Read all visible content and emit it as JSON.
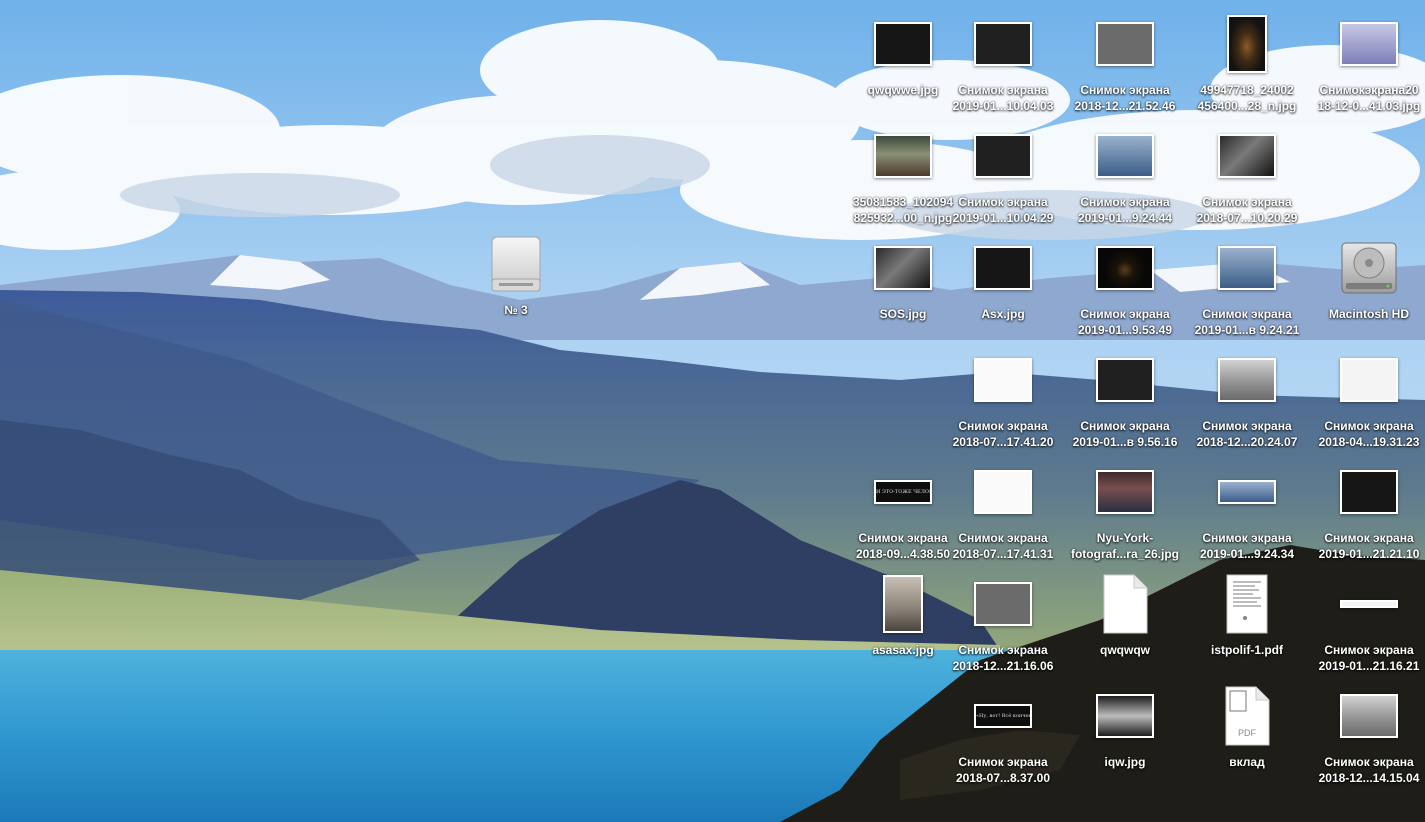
{
  "desktop": {
    "drive_icon": {
      "label": "№ 3",
      "icon": "external-drive-icon"
    },
    "icons": [
      {
        "name": "qwqwwe-jpg",
        "lines": [
          "qwqwwe.jpg"
        ],
        "kind": "image",
        "thumb": "w",
        "fill": "f-dark",
        "icon": "image-thumbnail-icon"
      },
      {
        "name": "screenshot-2019-01-10-04-03",
        "lines": [
          "Снимок экрана",
          "2019-01...10.04.03"
        ],
        "kind": "image",
        "thumb": "w",
        "fill": "f-dark2",
        "icon": "image-thumbnail-icon"
      },
      {
        "name": "screenshot-2018-12-21-52-46",
        "lines": [
          "Снимок экрана",
          "2018-12...21.52.46"
        ],
        "kind": "image",
        "thumb": "w",
        "fill": "f-gray",
        "icon": "image-thumbnail-icon"
      },
      {
        "name": "49947718-jpg",
        "lines": [
          "49947718_24002",
          "456400...28_n.jpg"
        ],
        "kind": "image",
        "thumb": "p",
        "fill": "f-bottle",
        "icon": "image-thumbnail-icon"
      },
      {
        "name": "snimokekrana2018-12-41-03",
        "lines": [
          "Снимокэкрана20",
          "18-12-0...41.03.jpg"
        ],
        "kind": "image",
        "thumb": "w",
        "fill": "f-lilac",
        "icon": "image-thumbnail-icon"
      },
      {
        "name": "35081583-jpg",
        "lines": [
          "35081583_102094",
          "825932...00_n.jpg"
        ],
        "kind": "image",
        "thumb": "w",
        "fill": "f-crowd",
        "icon": "image-thumbnail-icon"
      },
      {
        "name": "screenshot-2019-01-10-04-29",
        "lines": [
          "Снимок экрана",
          "2019-01...10.04.29"
        ],
        "kind": "image",
        "thumb": "w",
        "fill": "f-dark2",
        "icon": "image-thumbnail-icon"
      },
      {
        "name": "screenshot-2019-01-9-24-44",
        "lines": [
          "Снимок экрана",
          "2019-01...9.24.44"
        ],
        "kind": "image",
        "thumb": "w",
        "fill": "f-blue",
        "icon": "image-thumbnail-icon"
      },
      {
        "name": "screenshot-2018-07-10-20-29",
        "lines": [
          "Снимок экрана",
          "2018-07...10.20.29"
        ],
        "kind": "image",
        "thumb": "w",
        "fill": "f-bw",
        "icon": "image-thumbnail-icon"
      },
      {
        "name": "sos-jpg",
        "lines": [
          "SOS.jpg"
        ],
        "kind": "image",
        "thumb": "w",
        "fill": "f-bw",
        "icon": "image-thumbnail-icon"
      },
      {
        "name": "asx-jpg",
        "lines": [
          "Asx.jpg"
        ],
        "kind": "image",
        "thumb": "w",
        "fill": "f-dark",
        "icon": "image-thumbnail-icon"
      },
      {
        "name": "screenshot-2019-01-9-53-49",
        "lines": [
          "Снимок экрана",
          "2019-01...9.53.49"
        ],
        "kind": "image",
        "thumb": "w",
        "fill": "f-night",
        "icon": "image-thumbnail-icon"
      },
      {
        "name": "screenshot-2019-01-v-9-24-21",
        "lines": [
          "Снимок экрана",
          "2019-01...в 9.24.21"
        ],
        "kind": "image",
        "thumb": "w",
        "fill": "f-blue",
        "icon": "image-thumbnail-icon"
      },
      {
        "name": "macintosh-hd",
        "lines": [
          "Macintosh HD"
        ],
        "kind": "hd",
        "icon": "hard-drive-icon"
      },
      {
        "name": "screenshot-2018-07-17-41-20",
        "lines": [
          "Снимок экрана",
          "2018-07...17.41.20"
        ],
        "kind": "image",
        "thumb": "w",
        "fill": "f-sketch",
        "icon": "image-thumbnail-icon"
      },
      {
        "name": "screenshot-2019-01-v-9-56-16",
        "lines": [
          "Снимок экрана",
          "2019-01...в 9.56.16"
        ],
        "kind": "image",
        "thumb": "w",
        "fill": "f-dark2",
        "icon": "image-thumbnail-icon"
      },
      {
        "name": "screenshot-2018-12-20-24-07",
        "lines": [
          "Снимок экрана",
          "2018-12...20.24.07"
        ],
        "kind": "image",
        "thumb": "w",
        "fill": "f-grad",
        "icon": "image-thumbnail-icon"
      },
      {
        "name": "screenshot-2018-04-19-31-23",
        "lines": [
          "Снимок экрана",
          "2018-04...19.31.23"
        ],
        "kind": "image",
        "thumb": "w",
        "fill": "f-table",
        "icon": "image-thumbnail-icon"
      },
      {
        "name": "screenshot-2018-09-4-38-50",
        "lines": [
          "Снимок экрана",
          "2018-09...4.38.50"
        ],
        "kind": "image",
        "thumb": "s",
        "fill": "f-title",
        "icon": "image-thumbnail-icon",
        "caption": "И ЭТО-ТОЖЕ ЧЕЛОВЕК"
      },
      {
        "name": "screenshot-2018-07-17-41-31",
        "lines": [
          "Снимок экрана",
          "2018-07...17.41.31"
        ],
        "kind": "image",
        "thumb": "w",
        "fill": "f-sketch",
        "icon": "image-thumbnail-icon"
      },
      {
        "name": "nyu-york-fotograf-jpg",
        "lines": [
          "Nyu-York-",
          "fotograf...ra_26.jpg"
        ],
        "kind": "image",
        "thumb": "w",
        "fill": "f-room",
        "icon": "image-thumbnail-icon"
      },
      {
        "name": "screenshot-2019-01-9-24-34",
        "lines": [
          "Снимок экрана",
          "2019-01...9.24.34"
        ],
        "kind": "image",
        "thumb": "s",
        "fill": "f-blue",
        "icon": "image-thumbnail-icon"
      },
      {
        "name": "screenshot-2019-01-21-21-10",
        "lines": [
          "Снимок экрана",
          "2019-01...21.21.10"
        ],
        "kind": "image",
        "thumb": "w",
        "fill": "f-dark",
        "icon": "image-thumbnail-icon"
      },
      {
        "name": "asasax-jpg",
        "lines": [
          "asasax.jpg"
        ],
        "kind": "image",
        "thumb": "p",
        "fill": "f-portrait",
        "icon": "image-thumbnail-icon"
      },
      {
        "name": "screenshot-2018-12-21-16-06",
        "lines": [
          "Снимок экрана",
          "2018-12...21.16.06"
        ],
        "kind": "image",
        "thumb": "w",
        "fill": "f-gray",
        "icon": "image-thumbnail-icon"
      },
      {
        "name": "qwqwqw",
        "lines": [
          "qwqwqw"
        ],
        "kind": "blank",
        "icon": "blank-document-icon"
      },
      {
        "name": "istpolif-1-pdf",
        "lines": [
          "istpolif-1.pdf"
        ],
        "kind": "pdfpage",
        "icon": "pdf-page-icon"
      },
      {
        "name": "screenshot-2019-01-21-16-21",
        "lines": [
          "Снимок экрана",
          "2019-01...21.16.21"
        ],
        "kind": "image",
        "thumb": "t",
        "fill": "f-table",
        "icon": "image-thumbnail-icon"
      },
      {
        "name": "screenshot-2018-07-8-37-00",
        "lines": [
          "Снимок экрана",
          "2018-07...8.37.00"
        ],
        "kind": "image",
        "thumb": "s",
        "fill": "f-title",
        "icon": "image-thumbnail-icon",
        "caption": "«Ну, вот! Всё кончено...»"
      },
      {
        "name": "iqw-jpg",
        "lines": [
          "iqw.jpg"
        ],
        "kind": "image",
        "thumb": "w",
        "fill": "f-city",
        "icon": "image-thumbnail-icon"
      },
      {
        "name": "vklad",
        "lines": [
          "вклад"
        ],
        "kind": "pdf",
        "icon": "pdf-document-icon",
        "badge": "PDF"
      },
      {
        "name": "screenshot-2018-12-14-15-04",
        "lines": [
          "Снимок экрана",
          "2018-12...14.15.04"
        ],
        "kind": "image",
        "thumb": "w",
        "fill": "f-grad",
        "icon": "image-thumbnail-icon"
      }
    ]
  }
}
